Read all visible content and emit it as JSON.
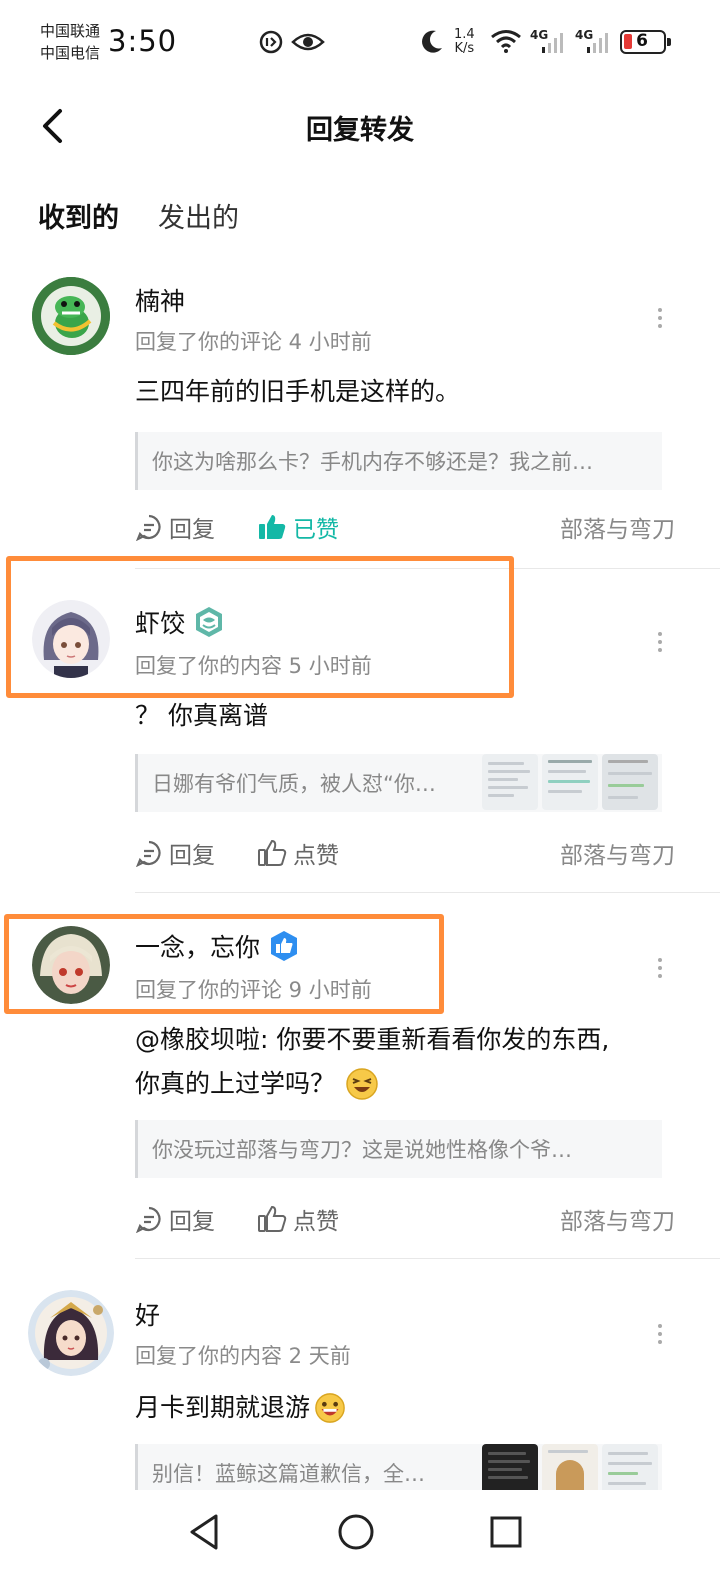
{
  "status_bar": {
    "carrier_1": "中国联通",
    "carrier_2": "中国电信",
    "time": "3:50",
    "net_speed_value": "1.4",
    "net_speed_unit": "K/s",
    "sim1": "4G",
    "sim2": "4G",
    "battery": "6"
  },
  "header": {
    "title": "回复转发"
  },
  "tabs": [
    {
      "label": "收到的"
    },
    {
      "label": "发出的"
    }
  ],
  "actions": {
    "reply": "回复",
    "like": "点赞",
    "liked": "已赞"
  },
  "items": [
    {
      "username": "楠神",
      "meta": "回复了你的评论 4 小时前",
      "content": "三四年前的旧手机是这样的。",
      "quote": "你这为啥那么卡？手机内存不够还是？我之前…",
      "liked": true,
      "source": "部落与弯刀"
    },
    {
      "username": "虾饺",
      "badge": "teal-hex-badge",
      "meta": "回复了你的内容 5 小时前",
      "content": "？ 你真离谱",
      "quote": "日娜有爷们气质，被人怼“你…",
      "liked": false,
      "source": "部落与弯刀"
    },
    {
      "username": "一念，忘你",
      "badge": "blue-thumb-badge",
      "meta": "回复了你的评论 9 小时前",
      "content_line1": "@橡胶坝啦: 你要不要重新看看你发的东西,",
      "content_line2": "你真的上过学吗？",
      "quote": "你没玩过部落与弯刀？这是说她性格像个爷…",
      "liked": false,
      "source": "部落与弯刀"
    },
    {
      "username": "好",
      "meta": "回复了你的内容 2 天前",
      "content": "月卡到期就退游",
      "quote": "别信！蓝鲸这篇道歉信，全…"
    }
  ],
  "colors": {
    "accent": "#17c3c0",
    "liked": "#14b8a6",
    "highlight": "#ff8c3a"
  }
}
